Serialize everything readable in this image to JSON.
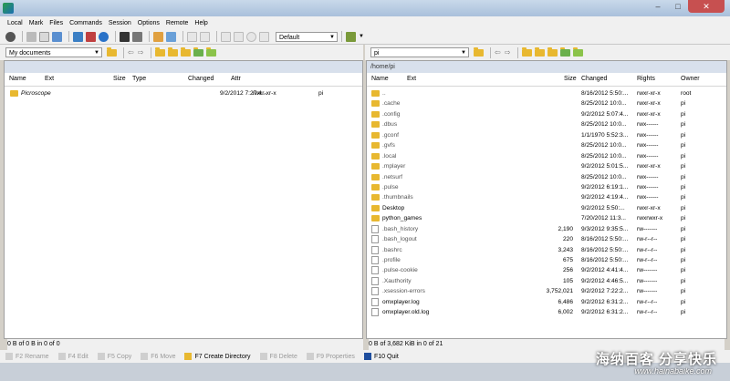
{
  "menu": [
    "Local",
    "Mark",
    "Files",
    "Commands",
    "Session",
    "Options",
    "Remote",
    "Help"
  ],
  "toolbar": {
    "transfer_settings": "Default"
  },
  "local": {
    "path_combo": "My documents",
    "columns": [
      "Name",
      "Ext",
      "Size",
      "Type",
      "Changed",
      "Attr"
    ],
    "rows": [
      {
        "name": "Picroscope",
        "size": "",
        "type": "",
        "changed": "9/2/2012 7:27:4...",
        "attr": "rwxr-xr-x",
        "owner": "pi"
      }
    ],
    "status": "0 B of 0 B in 0 of 0"
  },
  "remote": {
    "path_combo": "pi",
    "path_header": "/home/pi",
    "columns": [
      "Name",
      "Ext",
      "Size",
      "Changed",
      "Rights",
      "Owner"
    ],
    "rows": [
      {
        "name": "..",
        "size": "",
        "changed": "8/16/2012 5:50:...",
        "rights": "rwxr-xr-x",
        "owner": "root",
        "kind": "up"
      },
      {
        "name": ".cache",
        "size": "",
        "changed": "8/25/2012 10:0...",
        "rights": "rwxr-xr-x",
        "owner": "pi",
        "kind": "folder"
      },
      {
        "name": ".config",
        "size": "",
        "changed": "9/2/2012 5:07:4...",
        "rights": "rwxr-xr-x",
        "owner": "pi",
        "kind": "folder"
      },
      {
        "name": ".dbus",
        "size": "",
        "changed": "8/25/2012 10:0...",
        "rights": "rwx------",
        "owner": "pi",
        "kind": "folder"
      },
      {
        "name": ".gconf",
        "size": "",
        "changed": "1/1/1970 5:52:3...",
        "rights": "rwx------",
        "owner": "pi",
        "kind": "folder"
      },
      {
        "name": ".gvfs",
        "size": "",
        "changed": "8/25/2012 10:0...",
        "rights": "rwx------",
        "owner": "pi",
        "kind": "folder"
      },
      {
        "name": ".local",
        "size": "",
        "changed": "8/25/2012 10:0...",
        "rights": "rwx------",
        "owner": "pi",
        "kind": "folder"
      },
      {
        "name": ".mplayer",
        "size": "",
        "changed": "9/2/2012 5:01:5...",
        "rights": "rwxr-xr-x",
        "owner": "pi",
        "kind": "folder"
      },
      {
        "name": ".netsurf",
        "size": "",
        "changed": "8/25/2012 10:0...",
        "rights": "rwx------",
        "owner": "pi",
        "kind": "folder"
      },
      {
        "name": ".pulse",
        "size": "",
        "changed": "9/2/2012 6:19:1...",
        "rights": "rwx------",
        "owner": "pi",
        "kind": "folder"
      },
      {
        "name": ".thumbnails",
        "size": "",
        "changed": "9/2/2012 4:19:4...",
        "rights": "rwx------",
        "owner": "pi",
        "kind": "folder"
      },
      {
        "name": "Desktop",
        "size": "",
        "changed": "9/2/2012 5:50:...",
        "rights": "rwxr-xr-x",
        "owner": "pi",
        "kind": "folder"
      },
      {
        "name": "python_games",
        "size": "",
        "changed": "7/20/2012 11:3...",
        "rights": "rwxrwxr-x",
        "owner": "pi",
        "kind": "folder"
      },
      {
        "name": ".bash_history",
        "size": "2,190",
        "changed": "9/3/2012 9:35:5...",
        "rights": "rw-------",
        "owner": "pi",
        "kind": "file"
      },
      {
        "name": ".bash_logout",
        "size": "220",
        "changed": "8/16/2012 5:50:...",
        "rights": "rw-r--r--",
        "owner": "pi",
        "kind": "file"
      },
      {
        "name": ".bashrc",
        "size": "3,243",
        "changed": "8/16/2012 5:50:...",
        "rights": "rw-r--r--",
        "owner": "pi",
        "kind": "file"
      },
      {
        "name": ".profile",
        "size": "675",
        "changed": "8/16/2012 5:50:...",
        "rights": "rw-r--r--",
        "owner": "pi",
        "kind": "file"
      },
      {
        "name": ".pulse-cookie",
        "size": "256",
        "changed": "9/2/2012 4:41:4...",
        "rights": "rw-------",
        "owner": "pi",
        "kind": "file"
      },
      {
        "name": ".Xauthority",
        "size": "105",
        "changed": "9/2/2012 4:46:5...",
        "rights": "rw-------",
        "owner": "pi",
        "kind": "file"
      },
      {
        "name": ".xsession-errors",
        "size": "3,752,021",
        "changed": "9/2/2012 7:22:2...",
        "rights": "rw-------",
        "owner": "pi",
        "kind": "file"
      },
      {
        "name": "omxplayer.log",
        "size": "6,486",
        "changed": "9/2/2012 6:31:2...",
        "rights": "rw-r--r--",
        "owner": "pi",
        "kind": "file"
      },
      {
        "name": "omxplayer.old.log",
        "size": "6,002",
        "changed": "9/2/2012 6:31:2...",
        "rights": "rw-r--r--",
        "owner": "pi",
        "kind": "file"
      }
    ],
    "status": "0 B of 3,682 KiB in 0 of 21"
  },
  "fkeys": [
    {
      "label": "F2 Rename",
      "enabled": false,
      "icon": "rename-icon"
    },
    {
      "label": "F4 Edit",
      "enabled": false,
      "icon": "edit-icon"
    },
    {
      "label": "F5 Copy",
      "enabled": false,
      "icon": "copy-icon"
    },
    {
      "label": "F6 Move",
      "enabled": false,
      "icon": "move-icon"
    },
    {
      "label": "F7 Create Directory",
      "enabled": true,
      "icon": "folder-icon"
    },
    {
      "label": "F8 Delete",
      "enabled": false,
      "icon": "delete-icon"
    },
    {
      "label": "F9 Properties",
      "enabled": false,
      "icon": "properties-icon"
    },
    {
      "label": "F10 Quit",
      "enabled": true,
      "icon": "quit-icon"
    }
  ],
  "watermark": {
    "line1": "海纳百客 分享快乐",
    "line2": "www.hainabaike.com"
  },
  "colors": {
    "folder": "#e8b830",
    "panel_header": "#d8e0ec",
    "close": "#c75050"
  }
}
